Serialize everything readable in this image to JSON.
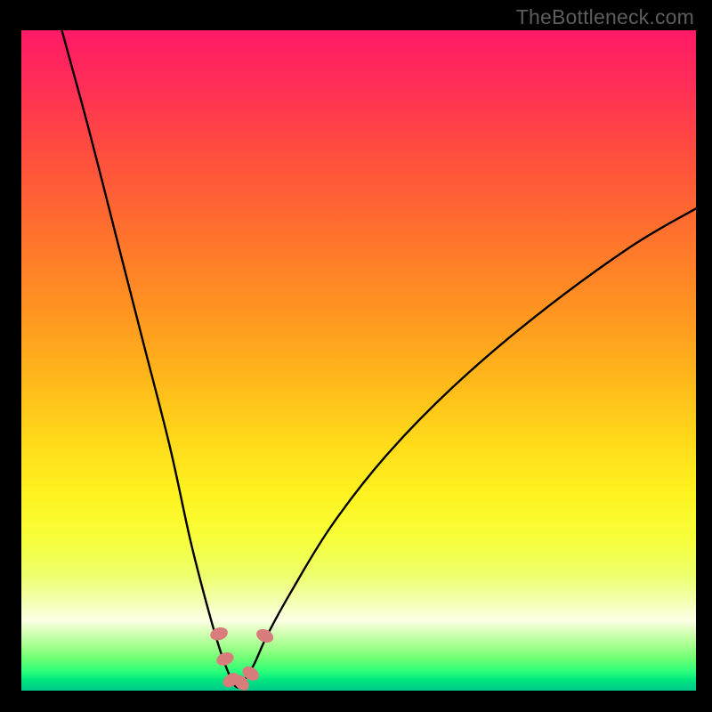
{
  "watermark": "TheBottleneck.com",
  "chart_data": {
    "type": "line",
    "title": "",
    "xlabel": "",
    "ylabel": "",
    "xlim": [
      0,
      100
    ],
    "ylim": [
      0,
      100
    ],
    "grid": false,
    "legend": false,
    "background": "heat-gradient-red-to-green",
    "minimum_x": 32,
    "series": [
      {
        "name": "bottleneck-curve",
        "x": [
          6,
          10,
          14,
          18,
          22,
          25,
          27.5,
          29.5,
          31,
          32,
          33,
          34.5,
          36.5,
          40,
          46,
          54,
          64,
          76,
          90,
          100
        ],
        "values": [
          100,
          85,
          69,
          53,
          37,
          23,
          13,
          6,
          2,
          0.5,
          1.5,
          4,
          8.5,
          15,
          25,
          35.5,
          46,
          56.5,
          67,
          73
        ]
      }
    ],
    "markers": [
      {
        "name": "dot-left-upper",
        "x": 29.3,
        "y": 8.6
      },
      {
        "name": "dot-left-mid",
        "x": 30.2,
        "y": 4.8
      },
      {
        "name": "dot-trough-1",
        "x": 31.1,
        "y": 1.6
      },
      {
        "name": "dot-trough-2",
        "x": 32.6,
        "y": 1.2
      },
      {
        "name": "dot-trough-3",
        "x": 34.0,
        "y": 2.6
      },
      {
        "name": "dot-right-upper",
        "x": 36.1,
        "y": 8.3
      }
    ],
    "marker_style": {
      "fill": "#d97c7c",
      "rx": 7,
      "ry": 10,
      "rotate_with_curve": true
    }
  }
}
